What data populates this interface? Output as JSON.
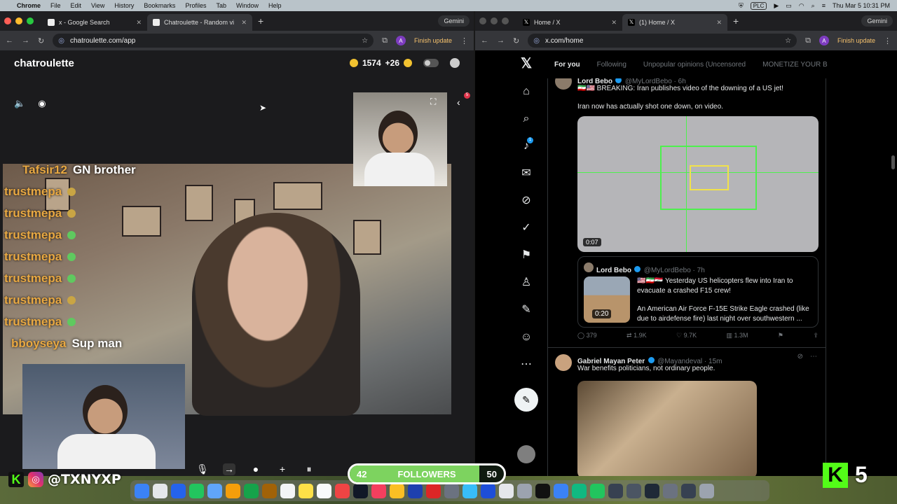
{
  "menubar": {
    "app": "Chrome",
    "items": [
      "File",
      "Edit",
      "View",
      "History",
      "Bookmarks",
      "Profiles",
      "Tab",
      "Window",
      "Help"
    ],
    "plc": "PLC",
    "datetime": "Thu Mar 5  10:31 PM"
  },
  "left_window": {
    "tabs": [
      {
        "title": "x - Google Search"
      },
      {
        "title": "Chatroulette - Random vi"
      }
    ],
    "gemini": "Gemini",
    "url": "chatroulette.com/app",
    "finish_update": "Finish update",
    "profile_initial": "A"
  },
  "chatroulette": {
    "logo": "chatroulette",
    "coins": "1574",
    "bonus": "+26",
    "notification_count": "5",
    "chat": [
      {
        "name": "Tafsir12",
        "message": "GN brother",
        "name_color": "#e8a842"
      },
      {
        "name": "trustmepa",
        "message": "",
        "emoji": "face-icon"
      },
      {
        "name": "trustmepa",
        "message": "",
        "emoji": "face-icon"
      },
      {
        "name": "trustmepa",
        "message": "",
        "emoji": "alien-icon"
      },
      {
        "name": "trustmepa",
        "message": "",
        "emoji": "smile-icon"
      },
      {
        "name": "trustmepa",
        "message": "",
        "emoji": "alien-icon"
      },
      {
        "name": "trustmepa",
        "message": "",
        "emoji": "face-icon"
      },
      {
        "name": "trustmepa",
        "message": "",
        "emoji": "alien-icon"
      },
      {
        "name": "bboyseya",
        "message": "Sup man"
      }
    ]
  },
  "right_window": {
    "tabs": [
      {
        "title": "Home / X"
      },
      {
        "title": "(1) Home / X"
      }
    ],
    "gemini": "Gemini",
    "url": "x.com/home",
    "finish_update": "Finish update",
    "profile_initial": "A"
  },
  "x": {
    "tabs": [
      "For you",
      "Following",
      "Unpopular opinions (Uncensored",
      "MONETIZE YOUR B"
    ],
    "notification_count": "1",
    "tweet1": {
      "name": "Lord Bebo",
      "handle": "@MyLordBebo · 6h",
      "text": "🇮🇷🇺🇸 BREAKING: Iran publishes video of the downing of a US jet!",
      "text2": "Iran now has actually shot one down, on video.",
      "video_duration": "0:07",
      "quote": {
        "name": "Lord Bebo",
        "handle": "@MyLordBebo · 7h",
        "text": "🇺🇸🇮🇷🇮🇶 Yesterday US helicopters flew into Iran to evacuate a crashed F15 crew!",
        "text2": "An American Air Force F-15E Strike Eagle crashed (like due to airdefense fire) last night over southwestern ...",
        "video_duration": "0:20"
      },
      "stats": {
        "replies": "379",
        "reposts": "1.9K",
        "likes": "9.7K",
        "views": "1.3M"
      }
    },
    "tweet2": {
      "name": "Gabriel Mayan Peter",
      "handle": "@Mayandeval · 15m",
      "text": "War benefits politicians, not ordinary people."
    }
  },
  "overlay": {
    "handle": "@TXNYXP",
    "followers_label": "FOLLOWERS",
    "followers_current": "42",
    "followers_goal": "50",
    "followers_progress": 0.84,
    "kick_count": "5"
  }
}
